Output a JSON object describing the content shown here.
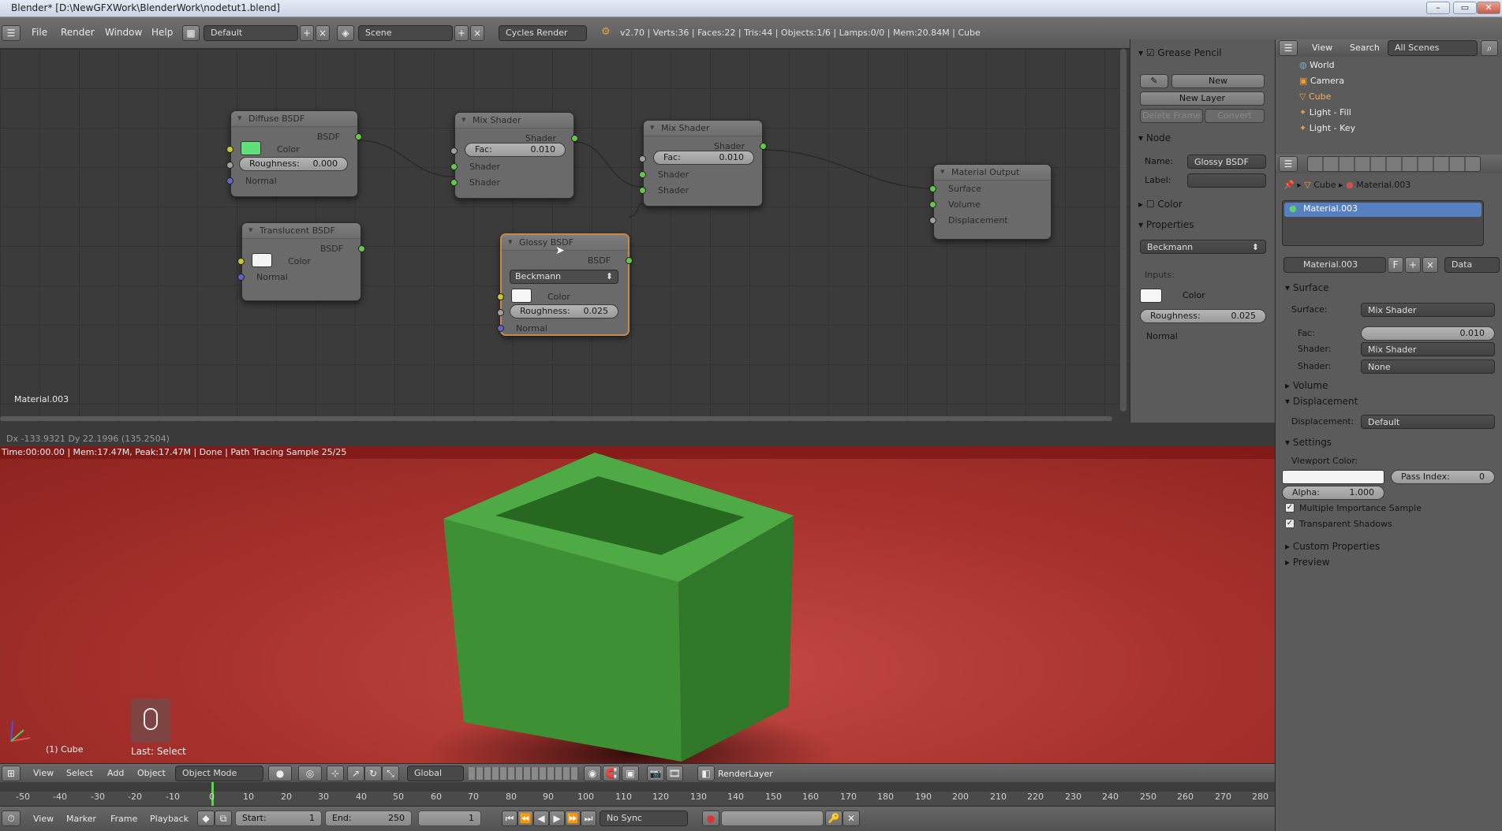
{
  "window": {
    "title": "Blender* [D:\\NewGFXWork\\BlenderWork\\nodetut1.blend]"
  },
  "menu": {
    "items": [
      "File",
      "Render",
      "Window",
      "Help"
    ],
    "layout": "Default",
    "scene": "Scene",
    "engine": "Cycles Render",
    "stats": "v2.70 | Verts:36 | Faces:22 | Tris:44 | Objects:1/6 | Lamps:0/0 | Mem:20.84M | Cube"
  },
  "nodes": {
    "diffuse": {
      "title": "Diffuse BSDF",
      "out": "BSDF",
      "color": "Color",
      "roughness_label": "Roughness:",
      "roughness": "0.000",
      "normal": "Normal"
    },
    "translucent": {
      "title": "Translucent BSDF",
      "out": "BSDF",
      "color": "Color",
      "normal": "Normal"
    },
    "mix1": {
      "title": "Mix Shader",
      "out": "Shader",
      "fac_label": "Fac:",
      "fac": "0.010",
      "in1": "Shader",
      "in2": "Shader"
    },
    "mix2": {
      "title": "Mix Shader",
      "out": "Shader",
      "fac_label": "Fac:",
      "fac": "0.010",
      "in1": "Shader",
      "in2": "Shader"
    },
    "glossy": {
      "title": "Glossy BSDF",
      "out": "BSDF",
      "dist": "Beckmann",
      "color": "Color",
      "roughness_label": "Roughness:",
      "roughness": "0.025",
      "normal": "Normal"
    },
    "output": {
      "title": "Material Output",
      "surface": "Surface",
      "volume": "Volume",
      "displacement": "Displacement"
    }
  },
  "node_editor": {
    "material_label": "Material.003",
    "status": "Dx -133.9321   Dy 22.1996 (135.2504)"
  },
  "npanel": {
    "grease_pencil": "Grease Pencil",
    "new": "New",
    "new_layer": "New Layer",
    "delete_frame": "Delete Frame",
    "convert": "Convert",
    "node": "Node",
    "name_label": "Name:",
    "name_value": "Glossy BSDF",
    "label_label": "Label:",
    "color": "Color",
    "properties": "Properties",
    "dist": "Beckmann",
    "inputs": "Inputs:",
    "in_color": "Color",
    "roughness_label": "Roughness:",
    "roughness": "0.025",
    "normal": "Normal"
  },
  "viewport": {
    "info": "Time:00:00.00 | Mem:17.47M, Peak:17.47M | Done | Path Tracing Sample 25/25",
    "object_label": "(1) Cube",
    "last_op": "Last: Select"
  },
  "header3d": {
    "items": [
      "View",
      "Select",
      "Add",
      "Object"
    ],
    "mode": "Object Mode",
    "orientation": "Global",
    "render_layer": "RenderLayer"
  },
  "timeline": {
    "ticks": [
      "-50",
      "-40",
      "-30",
      "-20",
      "-10",
      "0",
      "10",
      "20",
      "30",
      "40",
      "50",
      "60",
      "70",
      "80",
      "90",
      "100",
      "110",
      "120",
      "130",
      "140",
      "150",
      "160",
      "170",
      "180",
      "190",
      "200",
      "210",
      "220",
      "230",
      "240",
      "250",
      "260",
      "270",
      "280"
    ],
    "items": [
      "View",
      "Marker",
      "Frame",
      "Playback"
    ],
    "start_label": "Start:",
    "start": "1",
    "end_label": "End:",
    "end": "250",
    "current": "1",
    "sync": "No Sync"
  },
  "outliner": {
    "view": "View",
    "search": "Search",
    "scenes": "All Scenes",
    "rows": [
      "World",
      "Camera",
      "Cube",
      "Light - Fill",
      "Light - Key"
    ]
  },
  "properties": {
    "crumb_obj": "Cube",
    "crumb_mat": "Material.003",
    "slot": "Material.003",
    "mat_name": "Material.003",
    "f": "F",
    "data": "Data",
    "surface_h": "Surface",
    "surface_label": "Surface:",
    "surface_val": "Mix Shader",
    "fac_label": "Fac:",
    "fac_val": "0.010",
    "shader1_label": "Shader:",
    "shader1_val": "Mix Shader",
    "shader2_label": "Shader:",
    "shader2_val": "None",
    "volume_h": "Volume",
    "disp_h": "Displacement",
    "disp_label": "Displacement:",
    "disp_val": "Default",
    "settings_h": "Settings",
    "viewport_color": "Viewport Color:",
    "pass_index_label": "Pass Index:",
    "pass_index": "0",
    "alpha_label": "Alpha:",
    "alpha": "1.000",
    "mis": "Multiple Importance Sample",
    "transparent": "Transparent Shadows",
    "custom_props": "Custom Properties",
    "preview": "Preview"
  }
}
